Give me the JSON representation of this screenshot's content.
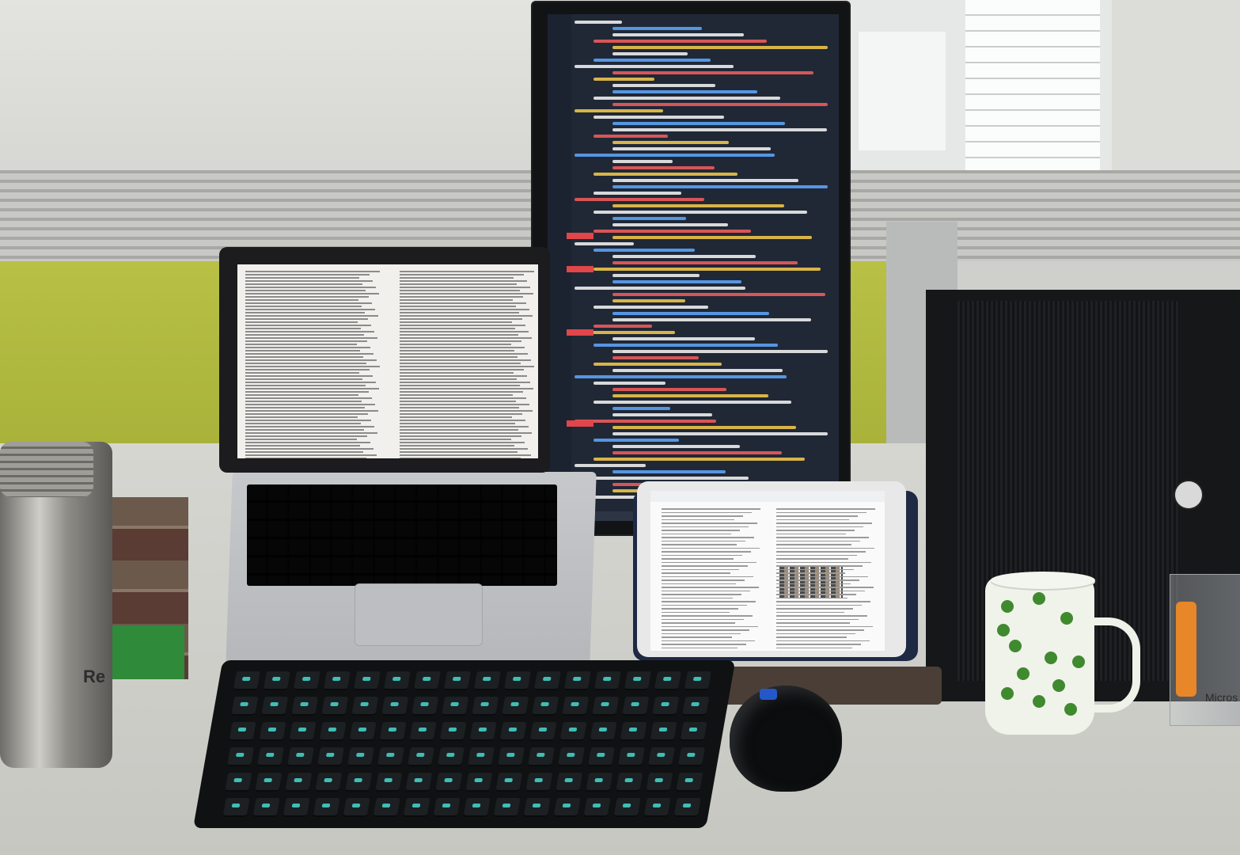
{
  "scene": {
    "description_elements": [
      "vertical-monitor",
      "laptop",
      "mechanical-keyboard",
      "tablet",
      "mouse",
      "thermos",
      "mug",
      "pc-tower",
      "pen-holder",
      "books"
    ]
  },
  "thermos": {
    "label": "Re"
  },
  "pen_holder": {
    "sticker_text": "Micros"
  },
  "colors": {
    "keyboard_backlight": "#47d9d0",
    "code_keyword": "#e85a5a",
    "code_text": "#e8e8e8",
    "code_blue": "#5aa0f0",
    "code_yellow": "#e8c04a",
    "partition_green": "#a9b23a"
  }
}
